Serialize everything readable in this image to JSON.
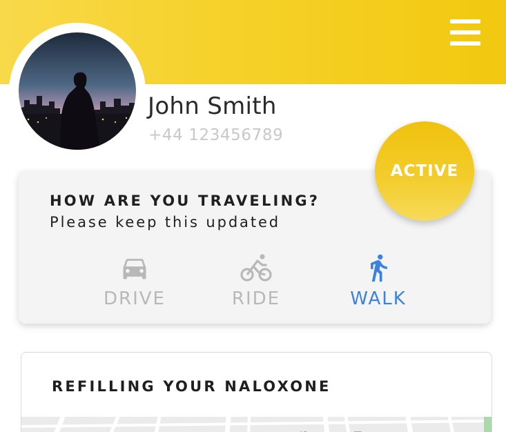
{
  "header": {
    "menu_icon": "hamburger-menu-icon",
    "background_color": "#f6d22c"
  },
  "profile": {
    "name": "John Smith",
    "phone": "+44 123456789"
  },
  "status": {
    "label": "ACTIVE",
    "color": "#f2c414"
  },
  "travel": {
    "title": "HOW ARE YOU TRAVELING?",
    "subtitle": "Please keep this updated",
    "modes": [
      {
        "label": "DRIVE",
        "icon": "car-icon",
        "selected": false
      },
      {
        "label": "RIDE",
        "icon": "bicycle-icon",
        "selected": false
      },
      {
        "label": "WALK",
        "icon": "walking-person-icon",
        "selected": true
      }
    ],
    "selected_color": "#3b82e0",
    "unselected_color": "#b8b8b8"
  },
  "refill": {
    "title": "REFILLING YOUR NALOXONE",
    "map_labels": [
      "St",
      "Rd"
    ]
  }
}
